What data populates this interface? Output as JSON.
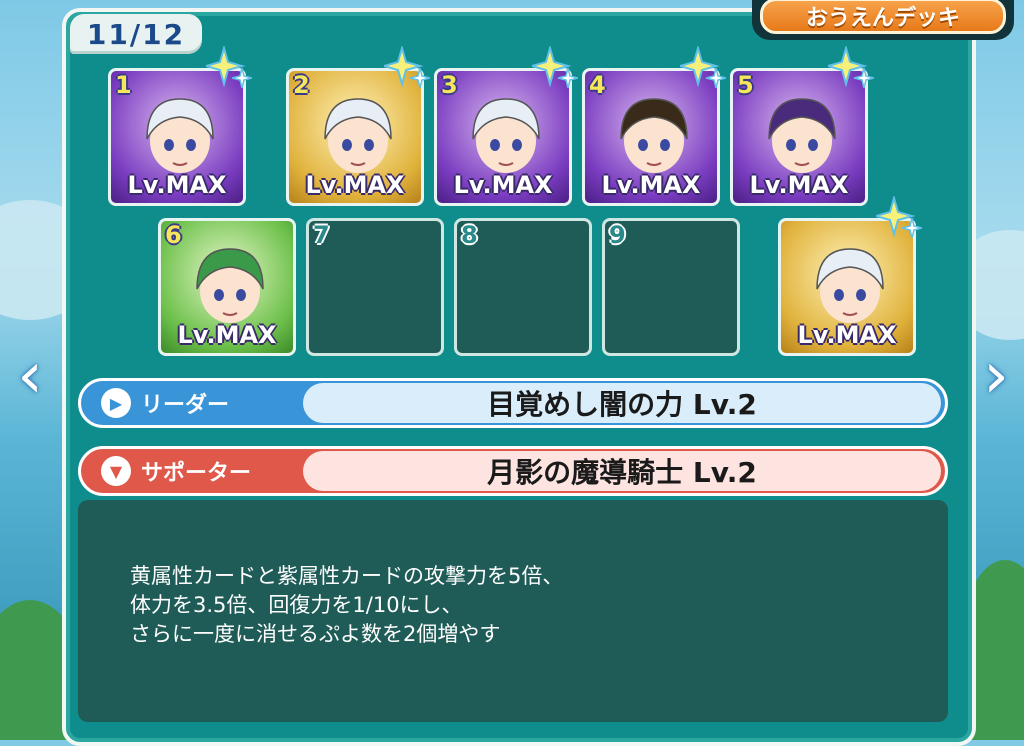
{
  "deck": {
    "counter": "11/12",
    "cheer_deck_label": "おうえんデッキ"
  },
  "cards": [
    {
      "num": "1",
      "level": "Lv.MAX",
      "frame": "purple",
      "filled": true
    },
    {
      "num": "2",
      "level": "Lv.MAX",
      "frame": "gold",
      "filled": true
    },
    {
      "num": "3",
      "level": "Lv.MAX",
      "frame": "purple",
      "filled": true
    },
    {
      "num": "4",
      "level": "Lv.MAX",
      "frame": "purple",
      "filled": true
    },
    {
      "num": "5",
      "level": "Lv.MAX",
      "frame": "purple",
      "filled": true
    },
    {
      "num": "6",
      "level": "Lv.MAX",
      "frame": "green",
      "filled": true
    },
    {
      "num": "7",
      "level": "",
      "frame": "empty",
      "filled": false
    },
    {
      "num": "8",
      "level": "",
      "frame": "empty",
      "filled": false
    },
    {
      "num": "9",
      "level": "",
      "frame": "empty",
      "filled": false
    },
    {
      "num": "",
      "level": "Lv.MAX",
      "frame": "gold",
      "filled": true
    }
  ],
  "leader": {
    "label": "リーダー",
    "skill": "目覚めし闇の力 Lv.2",
    "color": "#3a94d8"
  },
  "supporter": {
    "label": "サポーター",
    "skill": "月影の魔導騎士 Lv.2",
    "color": "#e0584a"
  },
  "description": {
    "line1": "黄属性カードと紫属性カードの攻撃力を5倍、",
    "line2": "体力を3.5倍、回復力を1/10にし、",
    "line3": "さらに一度に消せるぷよ数を2個増やす"
  },
  "nav": {
    "prev_icon": "chevron-left-icon",
    "next_icon": "chevron-right-icon"
  }
}
